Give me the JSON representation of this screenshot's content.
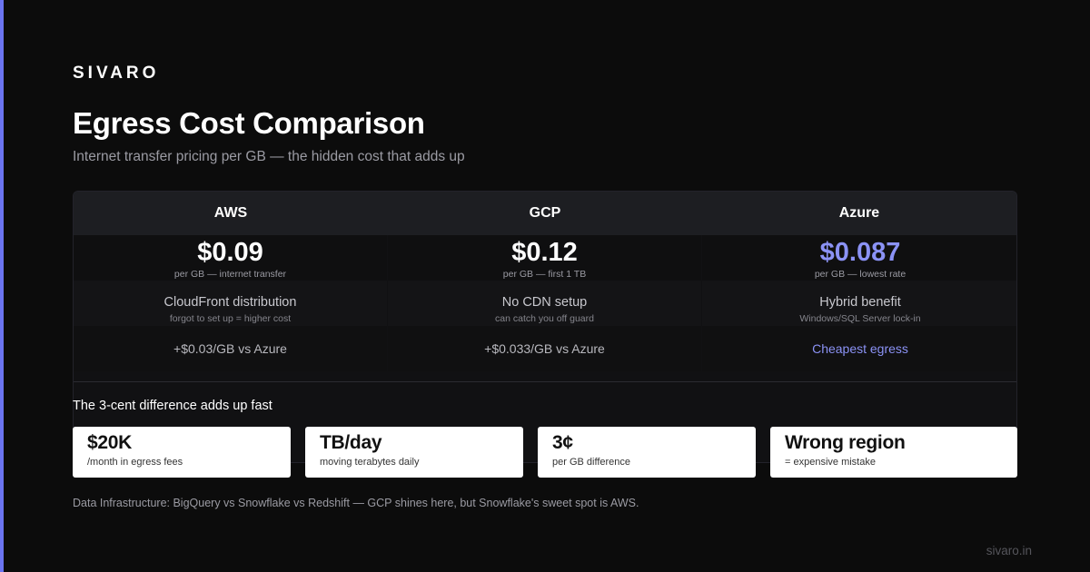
{
  "brand": "SIVARO",
  "title": "Egress Cost Comparison",
  "subtitle": "Internet transfer pricing per GB — the hidden cost that adds up",
  "columns": [
    {
      "name": "AWS",
      "price": "$0.09",
      "price_note": "per GB — internet transfer",
      "feature": "CloudFront distribution",
      "feature_note": "forgot to set up = higher cost",
      "delta": "+$0.03/GB vs Azure"
    },
    {
      "name": "GCP",
      "price": "$0.12",
      "price_note": "per GB — first 1 TB",
      "feature": "No CDN setup",
      "feature_note": "can catch you off guard",
      "delta": "+$0.033/GB vs Azure"
    },
    {
      "name": "Azure",
      "price": "$0.087",
      "price_note": "per GB — lowest rate",
      "feature": "Hybrid benefit",
      "feature_note": "Windows/SQL Server lock-in",
      "delta": "Cheapest egress"
    }
  ],
  "callout": "The 3-cent difference adds up fast",
  "stats": [
    {
      "value": "$20K",
      "label": "/month in egress fees"
    },
    {
      "value": "TB/day",
      "label": "moving terabytes daily"
    },
    {
      "value": "3¢",
      "label": "per GB difference"
    },
    {
      "value": "Wrong region",
      "label": "= expensive mistake"
    }
  ],
  "footnote": "Data Infrastructure: BigQuery vs Snowflake vs Redshift — GCP shines here, but Snowflake's sweet spot is AWS.",
  "site": "sivaro.in",
  "colors": {
    "accent": "#6b74f0",
    "highlight": "#8b92f5",
    "background": "#0c0c0c"
  }
}
